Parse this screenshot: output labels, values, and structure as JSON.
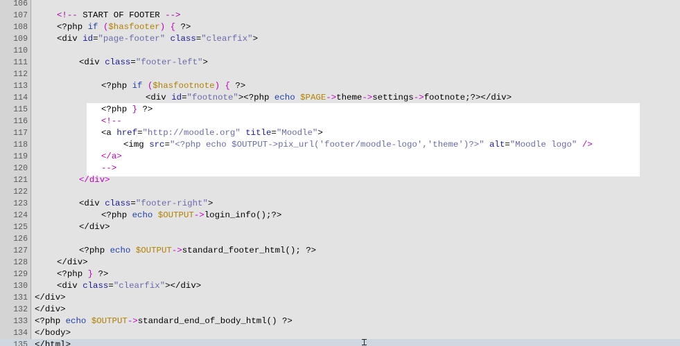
{
  "colors": {
    "background": "#e3e3e3",
    "gutter": "#d4d4d4",
    "selection": "#ffffff",
    "current_line": "#cfd8e0",
    "tag": "#000000",
    "attribute": "#1a1a9a",
    "string": "#6a6aaa",
    "keyword": "#1f3fb0",
    "variable": "#b08000",
    "operator": "#c000c0",
    "comment": "#a000a0"
  },
  "editor": {
    "current_line": "135",
    "lines": [
      {
        "num": "106",
        "indent": 0,
        "tokens": []
      },
      {
        "num": "107",
        "indent": 4,
        "tokens": [
          {
            "t": "cmt",
            "v": "<!-- "
          },
          {
            "t": "plain",
            "v": "START OF FOOTER"
          },
          {
            "t": "cmt",
            "v": " -->"
          }
        ]
      },
      {
        "num": "108",
        "indent": 4,
        "tokens": [
          {
            "t": "php",
            "v": "<?php "
          },
          {
            "t": "kw",
            "v": "if"
          },
          {
            "t": "plain",
            "v": " "
          },
          {
            "t": "op",
            "v": "("
          },
          {
            "t": "var",
            "v": "$hasfooter"
          },
          {
            "t": "op",
            "v": ")"
          },
          {
            "t": "plain",
            "v": " "
          },
          {
            "t": "op",
            "v": "{"
          },
          {
            "t": "plain",
            "v": " ?>"
          }
        ]
      },
      {
        "num": "109",
        "indent": 4,
        "tokens": [
          {
            "t": "tag",
            "v": "<div "
          },
          {
            "t": "attr",
            "v": "id"
          },
          {
            "t": "tag",
            "v": "="
          },
          {
            "t": "str",
            "v": "\"page-footer\""
          },
          {
            "t": "plain",
            "v": " "
          },
          {
            "t": "attr",
            "v": "class"
          },
          {
            "t": "tag",
            "v": "="
          },
          {
            "t": "str",
            "v": "\"clearfix\""
          },
          {
            "t": "tag",
            "v": ">"
          }
        ]
      },
      {
        "num": "110",
        "indent": 0,
        "tokens": []
      },
      {
        "num": "111",
        "indent": 8,
        "tokens": [
          {
            "t": "tag",
            "v": "<div "
          },
          {
            "t": "attr",
            "v": "class"
          },
          {
            "t": "tag",
            "v": "="
          },
          {
            "t": "str",
            "v": "\"footer-left\""
          },
          {
            "t": "tag",
            "v": ">"
          }
        ]
      },
      {
        "num": "112",
        "indent": 0,
        "tokens": []
      },
      {
        "num": "113",
        "indent": 12,
        "tokens": [
          {
            "t": "php",
            "v": "<?php "
          },
          {
            "t": "kw",
            "v": "if"
          },
          {
            "t": "plain",
            "v": " "
          },
          {
            "t": "op",
            "v": "("
          },
          {
            "t": "var",
            "v": "$hasfootnote"
          },
          {
            "t": "op",
            "v": ")"
          },
          {
            "t": "plain",
            "v": " "
          },
          {
            "t": "op",
            "v": "{"
          },
          {
            "t": "plain",
            "v": " ?>"
          }
        ]
      },
      {
        "num": "114",
        "indent": 20,
        "tokens": [
          {
            "t": "tag",
            "v": "<div "
          },
          {
            "t": "attr",
            "v": "id"
          },
          {
            "t": "tag",
            "v": "="
          },
          {
            "t": "str",
            "v": "\"footnote\""
          },
          {
            "t": "tag",
            "v": ">"
          },
          {
            "t": "php",
            "v": "<?php "
          },
          {
            "t": "kw",
            "v": "echo"
          },
          {
            "t": "plain",
            "v": " "
          },
          {
            "t": "var",
            "v": "$PAGE"
          },
          {
            "t": "op",
            "v": "->"
          },
          {
            "t": "plain",
            "v": "theme"
          },
          {
            "t": "op",
            "v": "->"
          },
          {
            "t": "plain",
            "v": "settings"
          },
          {
            "t": "op",
            "v": "->"
          },
          {
            "t": "plain",
            "v": "footnote;?>"
          },
          {
            "t": "tag",
            "v": "</div>"
          }
        ]
      },
      {
        "num": "115",
        "indent": 12,
        "tokens": [
          {
            "t": "php",
            "v": "<?php "
          },
          {
            "t": "op",
            "v": "}"
          },
          {
            "t": "plain",
            "v": " ?>"
          }
        ]
      },
      {
        "num": "116",
        "indent": 12,
        "tokens": [
          {
            "t": "cmt",
            "v": "<!--"
          }
        ]
      },
      {
        "num": "117",
        "indent": 12,
        "tokens": [
          {
            "t": "tag",
            "v": "<a "
          },
          {
            "t": "attr",
            "v": "href"
          },
          {
            "t": "tag",
            "v": "="
          },
          {
            "t": "str",
            "v": "\"http://moodle.org\""
          },
          {
            "t": "plain",
            "v": " "
          },
          {
            "t": "attr",
            "v": "title"
          },
          {
            "t": "tag",
            "v": "="
          },
          {
            "t": "str",
            "v": "\"Moodle\""
          },
          {
            "t": "tag",
            "v": ">"
          }
        ]
      },
      {
        "num": "118",
        "indent": 16,
        "tokens": [
          {
            "t": "tag",
            "v": "<img "
          },
          {
            "t": "attr",
            "v": "src"
          },
          {
            "t": "tag",
            "v": "="
          },
          {
            "t": "str",
            "v": "\"<?php echo $OUTPUT->pix_url('footer/moodle-logo','theme')?>\""
          },
          {
            "t": "plain",
            "v": " "
          },
          {
            "t": "attr",
            "v": "alt"
          },
          {
            "t": "tag",
            "v": "="
          },
          {
            "t": "str",
            "v": "\"Moodle logo\""
          },
          {
            "t": "plain",
            "v": " "
          },
          {
            "t": "op",
            "v": "/>"
          }
        ]
      },
      {
        "num": "119",
        "indent": 12,
        "tokens": [
          {
            "t": "op",
            "v": "</a>"
          }
        ]
      },
      {
        "num": "120",
        "indent": 12,
        "tokens": [
          {
            "t": "cmt",
            "v": "-->"
          }
        ]
      },
      {
        "num": "121",
        "indent": 8,
        "tokens": [
          {
            "t": "op",
            "v": "</div>"
          }
        ]
      },
      {
        "num": "122",
        "indent": 0,
        "tokens": []
      },
      {
        "num": "123",
        "indent": 8,
        "tokens": [
          {
            "t": "tag",
            "v": "<div "
          },
          {
            "t": "attr",
            "v": "class"
          },
          {
            "t": "tag",
            "v": "="
          },
          {
            "t": "str",
            "v": "\"footer-right\""
          },
          {
            "t": "tag",
            "v": ">"
          }
        ]
      },
      {
        "num": "124",
        "indent": 12,
        "tokens": [
          {
            "t": "php",
            "v": "<?php "
          },
          {
            "t": "kw",
            "v": "echo"
          },
          {
            "t": "plain",
            "v": " "
          },
          {
            "t": "var",
            "v": "$OUTPUT"
          },
          {
            "t": "op",
            "v": "->"
          },
          {
            "t": "plain",
            "v": "login_info();?>"
          }
        ]
      },
      {
        "num": "125",
        "indent": 8,
        "tokens": [
          {
            "t": "tag",
            "v": "</div>"
          }
        ]
      },
      {
        "num": "126",
        "indent": 0,
        "tokens": []
      },
      {
        "num": "127",
        "indent": 8,
        "tokens": [
          {
            "t": "php",
            "v": "<?php "
          },
          {
            "t": "kw",
            "v": "echo"
          },
          {
            "t": "plain",
            "v": " "
          },
          {
            "t": "var",
            "v": "$OUTPUT"
          },
          {
            "t": "op",
            "v": "->"
          },
          {
            "t": "plain",
            "v": "standard_footer_html(); ?>"
          }
        ]
      },
      {
        "num": "128",
        "indent": 4,
        "tokens": [
          {
            "t": "tag",
            "v": "</div>"
          }
        ]
      },
      {
        "num": "129",
        "indent": 4,
        "tokens": [
          {
            "t": "php",
            "v": "<?php "
          },
          {
            "t": "op",
            "v": "}"
          },
          {
            "t": "plain",
            "v": " ?>"
          }
        ]
      },
      {
        "num": "130",
        "indent": 4,
        "tokens": [
          {
            "t": "tag",
            "v": "<div "
          },
          {
            "t": "attr",
            "v": "class"
          },
          {
            "t": "tag",
            "v": "="
          },
          {
            "t": "str",
            "v": "\"clearfix\""
          },
          {
            "t": "tag",
            "v": "></div>"
          }
        ]
      },
      {
        "num": "131",
        "indent": 0,
        "tokens": [
          {
            "t": "tag",
            "v": "</div>"
          }
        ]
      },
      {
        "num": "132",
        "indent": 0,
        "tokens": [
          {
            "t": "tag",
            "v": "</div>"
          }
        ]
      },
      {
        "num": "133",
        "indent": 0,
        "tokens": [
          {
            "t": "php",
            "v": "<?php "
          },
          {
            "t": "kw",
            "v": "echo"
          },
          {
            "t": "plain",
            "v": " "
          },
          {
            "t": "var",
            "v": "$OUTPUT"
          },
          {
            "t": "op",
            "v": "->"
          },
          {
            "t": "plain",
            "v": "standard_end_of_body_html() ?>"
          }
        ]
      },
      {
        "num": "134",
        "indent": 0,
        "tokens": [
          {
            "t": "tag",
            "v": "</body>"
          }
        ]
      },
      {
        "num": "135",
        "indent": 0,
        "tokens": [
          {
            "t": "tag",
            "v": "</html>"
          }
        ]
      }
    ]
  }
}
